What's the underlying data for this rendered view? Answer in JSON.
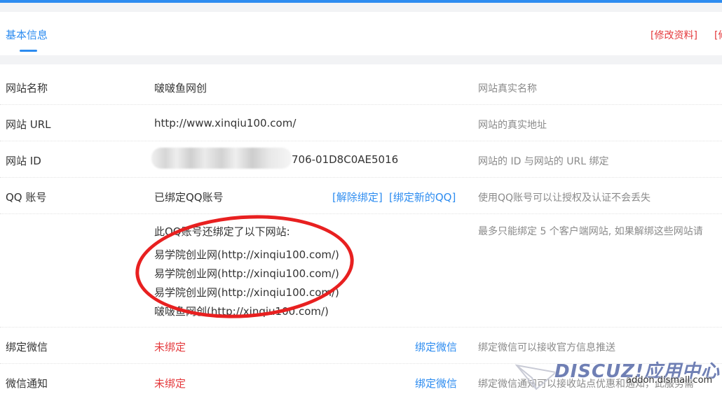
{
  "header": {
    "tab_label": "基本信息",
    "edit_profile_link": "[修改资料]",
    "cut_link": "[修"
  },
  "rows": {
    "site_name": {
      "label": "网站名称",
      "value": "啵啵鱼网创",
      "hint": "网站真实名称"
    },
    "site_url": {
      "label": "网站 URL",
      "value": "http://www.xinqiu100.com/",
      "hint": "网站的真实地址"
    },
    "site_id": {
      "label": "网站 ID",
      "value": "706-01D8C0AE5016",
      "hint": "网站的 ID 与网站的 URL 绑定"
    },
    "qq": {
      "label": "QQ 账号",
      "value": "已绑定QQ账号",
      "unbind_link": "[解除绑定]",
      "bind_new_link": "[绑定新的QQ]",
      "hint": "使用QQ账号可以让授权及认证不会丢失"
    },
    "bound_sites": {
      "intro": "此QQ账号还绑定了以下网站:",
      "sites": [
        "易学院创业网(http://xinqiu100.com/)",
        "易学院创业网(http://xinqiu100.com/)",
        "易学院创业网(http://xinqiu100.com/)",
        "啵啵鱼网创(http://xinqiu100.com/)"
      ],
      "hint": "最多只能绑定 5 个客户端网站, 如果解绑这些网站请"
    },
    "wechat_bind": {
      "label": "绑定微信",
      "status": "未绑定",
      "action": "绑定微信",
      "hint": "绑定微信可以接收官方信息推送"
    },
    "wechat_notify": {
      "label": "微信通知",
      "status": "未绑定",
      "action": "绑定微信",
      "hint": "绑定微信通知可以接收站点优惠和通知，此服务需"
    }
  },
  "watermark": {
    "brand": "DISCUZ!应用中心",
    "domain": "addon.dismall.com"
  },
  "colors": {
    "accent": "#2d8cf0",
    "danger": "#e4393c",
    "annotation_ring": "#e82020"
  }
}
